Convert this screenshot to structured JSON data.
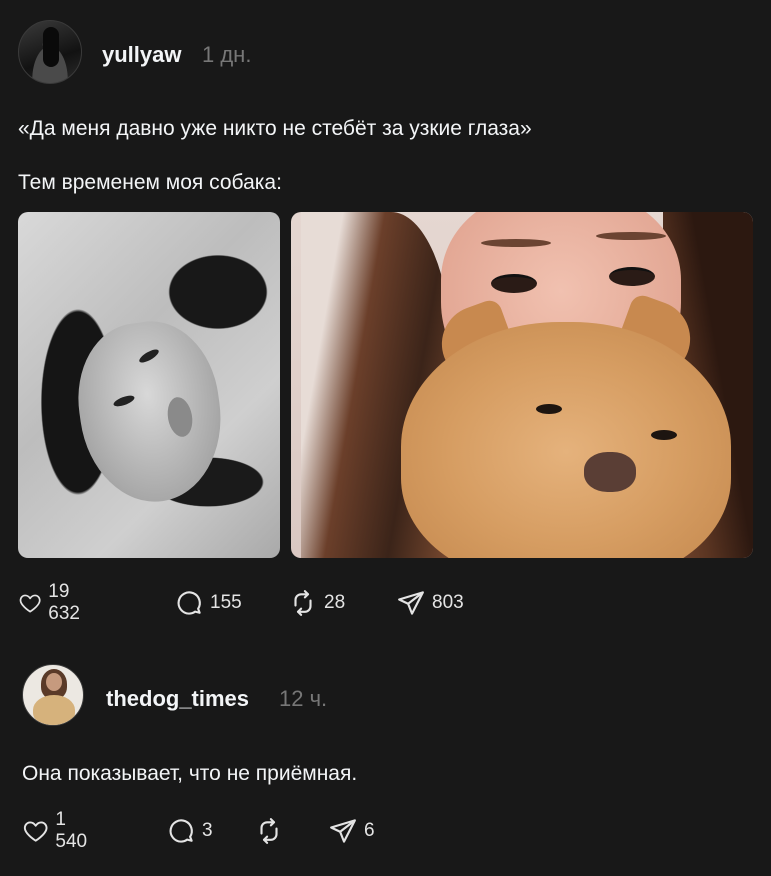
{
  "posts": [
    {
      "author": "yullyaw",
      "time": "1 дн.",
      "text": [
        "«Да меня давно уже никто не стебёт за узкие глаза»",
        "Тем временем моя собака:"
      ],
      "images": [
        "photo-bw-portrait",
        "photo-girl-with-dog"
      ],
      "actions": {
        "likes": "19 632",
        "comments": "155",
        "reposts": "28",
        "shares": "803"
      }
    },
    {
      "author": "thedog_times",
      "time": "12 ч.",
      "text": [
        "Она показывает, что не приёмная."
      ],
      "actions": {
        "likes": "1 540",
        "comments": "3",
        "reposts": "",
        "shares": "6"
      }
    }
  ],
  "icons": {
    "like": "heart-icon",
    "comment": "comment-bubble-icon",
    "repost": "repost-icon",
    "share": "send-icon"
  },
  "colors": {
    "background": "#181818",
    "text": "#f3f5f7",
    "muted": "#777777"
  }
}
